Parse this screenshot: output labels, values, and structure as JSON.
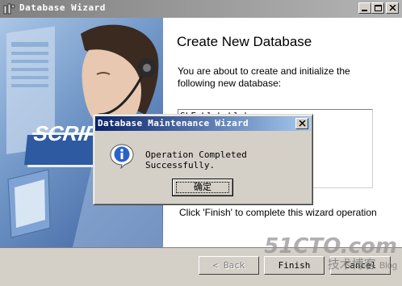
{
  "window": {
    "title": "Database Wizard"
  },
  "illustration": {
    "banner_text": "SCRIP"
  },
  "panel": {
    "heading": "Create New Database",
    "intro": "You are about to create and initialize the following new database:",
    "list_item_partial": "SLF_blah_blah",
    "finish_note": "Click 'Finish' to complete this wizard operation"
  },
  "buttons": {
    "back": "< Back",
    "finish": "Finish",
    "cancel": "Cancel"
  },
  "dialog": {
    "title": "Database Maintenance Wizard",
    "message": "Operation Completed Successfully.",
    "ok_label": "确定"
  },
  "watermark": {
    "site": "51CTO.com",
    "tag": "技术博客",
    "suffix": "Blog"
  },
  "colors": {
    "dialog_title_start": "#0a246a",
    "dialog_title_end": "#a6caf0",
    "info_blue": "#2a62c8"
  }
}
